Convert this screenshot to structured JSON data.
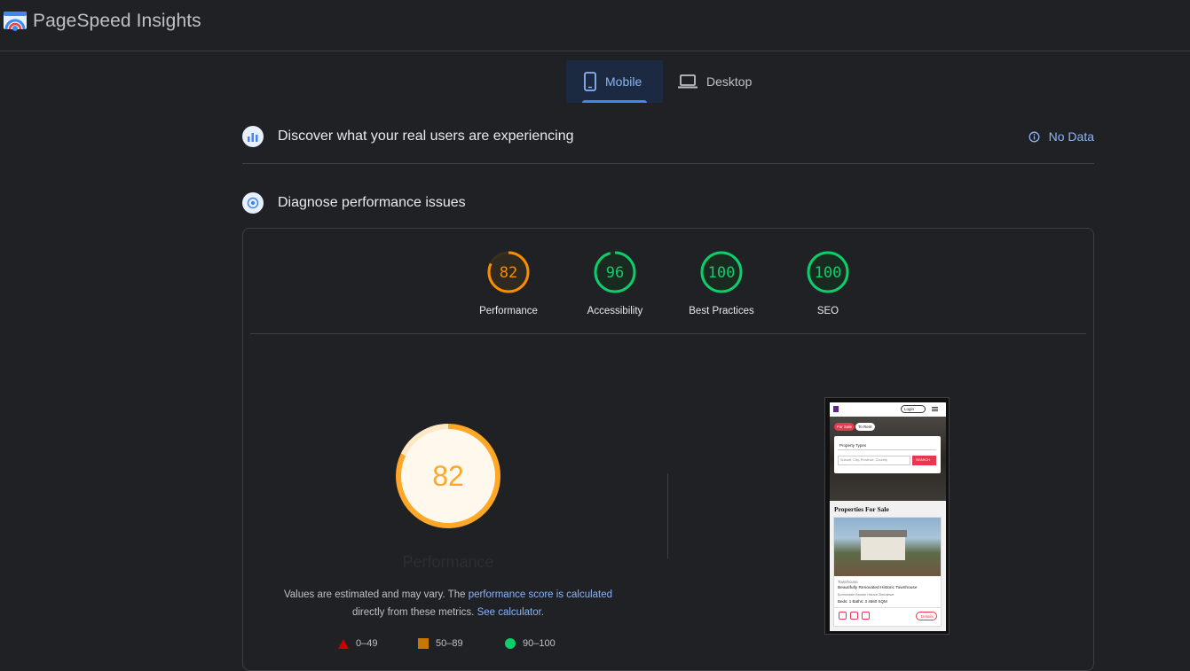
{
  "app": {
    "title": "PageSpeed Insights"
  },
  "tabs": [
    {
      "label": "Mobile",
      "active": true
    },
    {
      "label": "Desktop",
      "active": false
    }
  ],
  "field_data": {
    "title": "Discover what your real users are experiencing",
    "status": "No Data"
  },
  "lab_data": {
    "title": "Diagnose performance issues"
  },
  "scores": [
    {
      "label": "Performance",
      "value": "82",
      "color": "#fb8c00"
    },
    {
      "label": "Accessibility",
      "value": "96",
      "color": "#0cce6b"
    },
    {
      "label": "Best Practices",
      "value": "100",
      "color": "#0cce6b"
    },
    {
      "label": "SEO",
      "value": "100",
      "color": "#0cce6b"
    }
  ],
  "main_score": {
    "value": "82",
    "label": "Performance",
    "color": "#ffa726"
  },
  "note": {
    "text1": "Values are estimated and may vary. The ",
    "link1": "performance score is calculated",
    "text2": "directly from these metrics. ",
    "link2": "See calculator."
  },
  "legend": [
    {
      "range": "0–49",
      "shape": "triangle",
      "color": "#cc0000"
    },
    {
      "range": "50–89",
      "shape": "square",
      "color": "#c77800"
    },
    {
      "range": "90–100",
      "shape": "circle",
      "color": "#0cce6b"
    }
  ],
  "screenshot": {
    "login": "Login",
    "for_sale": "For Sale",
    "to_rent": "To Rent",
    "property_types": "Property Types",
    "search_placeholder": "Suburb, City, Province, Country",
    "search_btn": "SEARCH",
    "heading": "Properties For Sale",
    "listing_type": "Townhouse",
    "listing_title": "Beautifully Renovated Historic Townhouse",
    "listing_location": "Borrowdale Brooke Harare Zimbabwe",
    "listing_meta": "Beds: 1   Baths: 3   4660 SQM",
    "details_btn": "Details"
  }
}
